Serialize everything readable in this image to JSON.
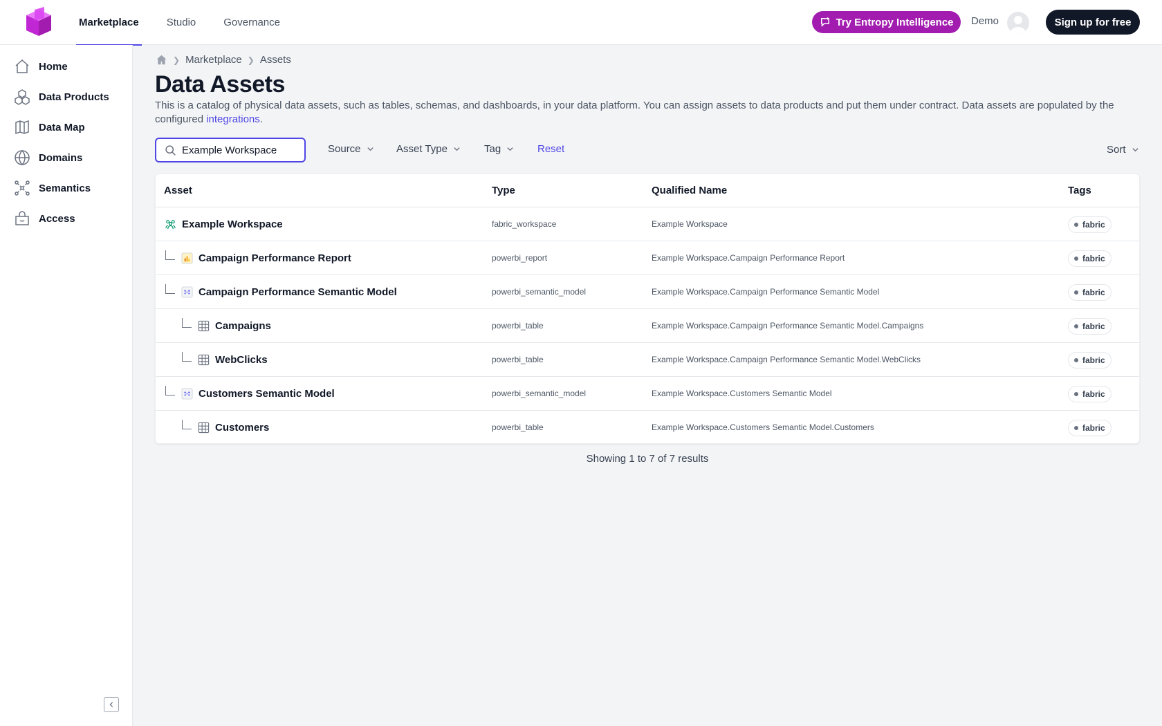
{
  "header": {
    "tabs": [
      {
        "label": "Marketplace",
        "active": true
      },
      {
        "label": "Studio",
        "active": false
      },
      {
        "label": "Governance",
        "active": false
      }
    ],
    "ai_button": "Try Entropy Intelligence",
    "user_label": "Demo",
    "signup_button": "Sign up for free",
    "accent": "#a21caf"
  },
  "sidebar": {
    "items": [
      {
        "label": "Home",
        "icon": "home-icon"
      },
      {
        "label": "Data Products",
        "icon": "cubes-icon"
      },
      {
        "label": "Data Map",
        "icon": "map-icon"
      },
      {
        "label": "Domains",
        "icon": "globe-icon"
      },
      {
        "label": "Semantics",
        "icon": "network-icon"
      },
      {
        "label": "Access",
        "icon": "lock-box-icon"
      }
    ]
  },
  "breadcrumb": [
    "Marketplace",
    "Assets"
  ],
  "page": {
    "title": "Data Assets",
    "description": "This is a catalog of physical data assets, such as tables, schemas, and dashboards, in your data platform. You can assign assets to data products and put them under contract. Data assets are populated by the configured ",
    "description_link": "integrations",
    "description_end": "."
  },
  "filters": {
    "search_value": "Example Workspace",
    "source": "Source",
    "asset_type": "Asset Type",
    "tag": "Tag",
    "reset": "Reset",
    "sort": "Sort"
  },
  "table": {
    "headers": [
      "Asset",
      "Type",
      "Qualified Name",
      "Tags"
    ],
    "rows": [
      {
        "name": "Example Workspace",
        "type": "fabric_workspace",
        "qualified_name": "Example Workspace",
        "tag": "fabric",
        "icon": "workspace-icon"
      },
      {
        "name": "Campaign Performance Report",
        "type": "powerbi_report",
        "qualified_name": "Example Workspace.Campaign Performance Report",
        "tag": "fabric",
        "icon": "report-icon"
      },
      {
        "name": "Campaign Performance Semantic Model",
        "type": "powerbi_semantic_model",
        "qualified_name": "Example Workspace.Campaign Performance Semantic Model",
        "tag": "fabric",
        "icon": "semantic-model-icon"
      },
      {
        "name": "Campaigns",
        "type": "powerbi_table",
        "qualified_name": "Example Workspace.Campaign Performance Semantic Model.Campaigns",
        "tag": "fabric",
        "icon": "table-icon"
      },
      {
        "name": "WebClicks",
        "type": "powerbi_table",
        "qualified_name": "Example Workspace.Campaign Performance Semantic Model.WebClicks",
        "tag": "fabric",
        "icon": "table-icon"
      },
      {
        "name": "Customers Semantic Model",
        "type": "powerbi_semantic_model",
        "qualified_name": "Example Workspace.Customers Semantic Model",
        "tag": "fabric",
        "icon": "semantic-model-icon"
      },
      {
        "name": "Customers",
        "type": "powerbi_table",
        "qualified_name": "Example Workspace.Customers Semantic Model.Customers",
        "tag": "fabric",
        "icon": "table-icon"
      }
    ]
  },
  "results_text": "Showing 1 to 7 of 7 results"
}
